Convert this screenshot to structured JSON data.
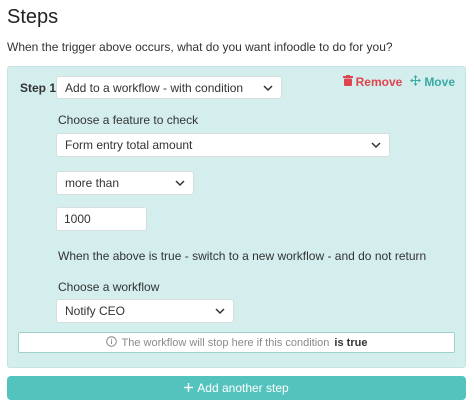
{
  "page": {
    "title": "Steps",
    "subtitle": "When the trigger above occurs, what do you want infoodle to do for you?"
  },
  "step": {
    "label": "Step 1.",
    "action_value": "Add to a workflow - with condition",
    "remove_label": "Remove",
    "move_label": "Move",
    "feature_label": "Choose a feature to check",
    "feature_value": "Form entry total amount",
    "compare_value": "more than",
    "amount_value": "1000",
    "true_label": "When the above is true - switch to a new workflow - and do not return",
    "workflow_label": "Choose a workflow",
    "workflow_value": "Notify CEO",
    "stop_note_prefix": "The workflow will stop here if this condition",
    "stop_note_bold": "is true"
  },
  "add_step": {
    "label": "Add another step"
  },
  "icons": {
    "remove": "trash-icon",
    "move": "move-arrows-icon",
    "dropdown": "chevron-down-icon",
    "info": "info-circle-icon",
    "add": "plus-icon"
  },
  "colors": {
    "card_bg": "#d3eeed",
    "accent": "#55c3bd",
    "remove": "#e0454f",
    "move": "#3aa9a4"
  }
}
